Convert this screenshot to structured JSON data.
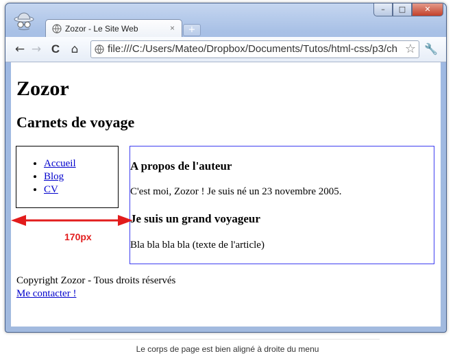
{
  "browser": {
    "tab_title": "Zozor - Le Site Web",
    "tab_close": "×",
    "new_tab": "+",
    "url": "file:///C:/Users/Mateo/Dropbox/Documents/Tutos/html-css/p3/ch",
    "window_buttons": {
      "minimize": "–",
      "maximize": "□",
      "close": "✕"
    },
    "nav": {
      "back": "←",
      "forward": "→",
      "reload": "C",
      "home": "⌂",
      "star": "☆",
      "wrench": "🔧"
    }
  },
  "page": {
    "h1": "Zozor",
    "h2": "Carnets de voyage",
    "menu": [
      "Accueil",
      "Blog",
      "CV"
    ],
    "article": {
      "heading1": "A propos de l'auteur",
      "text1": "C'est moi, Zozor ! Je suis né un 23 novembre 2005.",
      "heading2": "Je suis un grand voyageur",
      "text2": "Bla bla bla bla (texte de l'article)"
    },
    "footer": {
      "copyright": "Copyright Zozor - Tous droits réservés",
      "contact": "Me contacter !"
    }
  },
  "annotation": {
    "measure": "170px",
    "color": "#e21c1c"
  },
  "caption": "Le corps de page est bien aligné à droite du menu"
}
